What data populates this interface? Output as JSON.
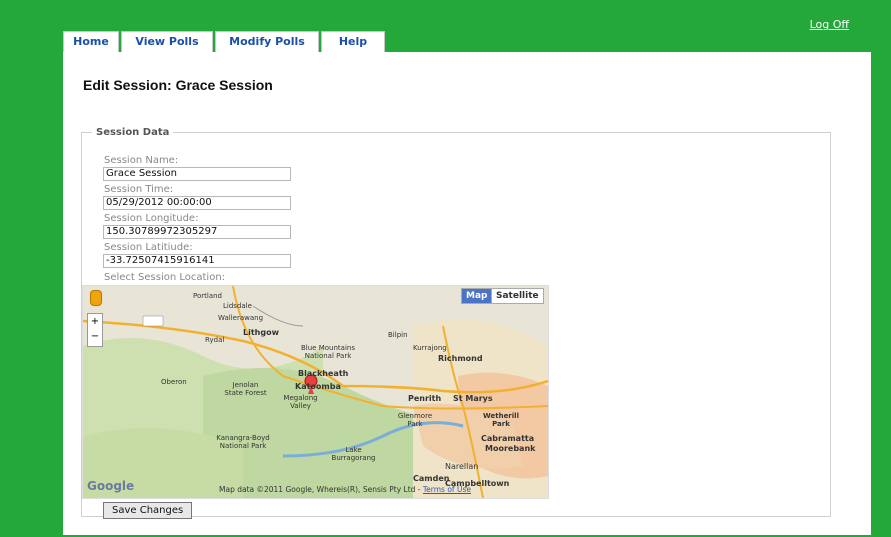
{
  "header": {
    "logoff_label": "Log Off"
  },
  "tabs": [
    {
      "label": "Home"
    },
    {
      "label": "View Polls"
    },
    {
      "label": "Modify Polls"
    },
    {
      "label": "Help"
    }
  ],
  "page": {
    "title": "Edit Session: Grace Session"
  },
  "form": {
    "legend": "Session Data",
    "fields": [
      {
        "label": "Session Name:",
        "value": "Grace Session"
      },
      {
        "label": "Session Time:",
        "value": "05/29/2012 00:00:00"
      },
      {
        "label": "Session Longitude:",
        "value": "150.30789972305297"
      },
      {
        "label": "Session Latitiude:",
        "value": "-33.72507415916141"
      }
    ],
    "map_label": "Select Session Location:",
    "save_label": "Save Changes"
  },
  "map": {
    "map_btn": "Map",
    "satellite_btn": "Satellite",
    "zoom_in": "+",
    "zoom_out": "−",
    "attribution": "Map data ©2011 Google, Whereis(R), Sensis Pty Ltd -",
    "terms": "Terms of Use",
    "google_logo": "Google",
    "places": [
      "Portland",
      "Lidsdale",
      "Wallerawang",
      "Lithgow",
      "Rydal",
      "Bilpin",
      "Kurrajong",
      "Blue Mountains National Park",
      "Richmond",
      "Blackheath",
      "Katoomba",
      "Penrith",
      "St Marys",
      "Oberon",
      "Jenolan State Forest",
      "Megalong Valley",
      "Kanangra-Boyd National Park",
      "Lake Burragorang",
      "Camden",
      "Campbelltown",
      "Cabramatta",
      "Moorebank",
      "Narellan",
      "Glenmore Park",
      "Wetherill Park"
    ]
  }
}
